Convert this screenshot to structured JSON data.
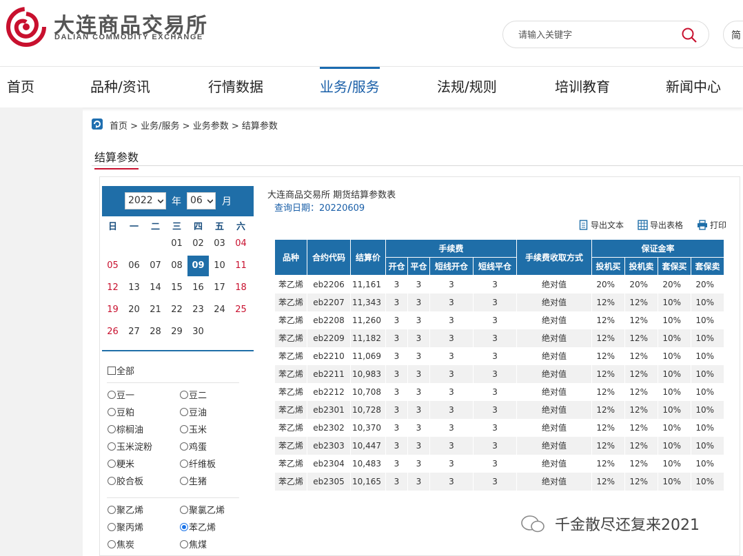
{
  "header": {
    "logo_cn": "大连商品交易所",
    "logo_en": "DALIAN COMMODITY EXCHANGE",
    "search_placeholder": "请输入关键字",
    "lang_label": "简"
  },
  "nav": [
    "首页",
    "品种/资讯",
    "行情数据",
    "业务/服务",
    "法规/规则",
    "培训教育",
    "新闻中心"
  ],
  "nav_active": "业务/服务",
  "breadcrumb": "首页 > 业务/服务 > 业务参数 > 结算参数",
  "page_title": "结算参数",
  "calendar": {
    "year": "2022",
    "year_label": "年",
    "month": "06",
    "month_label": "月",
    "weekdays": [
      "日",
      "一",
      "二",
      "三",
      "四",
      "五",
      "六"
    ],
    "first_weekday": 3,
    "days_in_month": 30,
    "selected_day": 9
  },
  "varieties": {
    "all_label": "全部",
    "group1": [
      "豆一",
      "豆二",
      "豆粕",
      "豆油",
      "棕榈油",
      "玉米",
      "玉米淀粉",
      "鸡蛋",
      "粳米",
      "纤维板",
      "胶合板",
      "生猪"
    ],
    "group2": [
      "聚乙烯",
      "聚氯乙烯",
      "聚丙烯",
      "苯乙烯",
      "焦炭",
      "焦煤"
    ],
    "selected": "苯乙烯"
  },
  "table": {
    "title": "大连商品交易所 期货结算参数表",
    "query_date": "查询日期：20220609",
    "tools": {
      "export_text": "导出文本",
      "export_table": "导出表格",
      "print": "打印"
    },
    "headers": {
      "variety": "品种",
      "contract": "合约代码",
      "settle_price": "结算价",
      "fee_group": "手续费",
      "fee_open": "开仓",
      "fee_close": "平仓",
      "fee_short_open": "短线开仓",
      "fee_short_close": "短线平仓",
      "fee_method": "手续费收取方式",
      "margin_group": "保证金率",
      "spec_buy": "投机买",
      "spec_sell": "投机卖",
      "hedge_buy": "套保买",
      "hedge_sell": "套保卖"
    },
    "rows": [
      [
        "苯乙烯",
        "eb2206",
        "11,161",
        "3",
        "3",
        "3",
        "3",
        "绝对值",
        "20%",
        "20%",
        "20%",
        "20%"
      ],
      [
        "苯乙烯",
        "eb2207",
        "11,343",
        "3",
        "3",
        "3",
        "3",
        "绝对值",
        "12%",
        "12%",
        "10%",
        "10%"
      ],
      [
        "苯乙烯",
        "eb2208",
        "11,260",
        "3",
        "3",
        "3",
        "3",
        "绝对值",
        "12%",
        "12%",
        "10%",
        "10%"
      ],
      [
        "苯乙烯",
        "eb2209",
        "11,182",
        "3",
        "3",
        "3",
        "3",
        "绝对值",
        "12%",
        "12%",
        "10%",
        "10%"
      ],
      [
        "苯乙烯",
        "eb2210",
        "11,069",
        "3",
        "3",
        "3",
        "3",
        "绝对值",
        "12%",
        "12%",
        "10%",
        "10%"
      ],
      [
        "苯乙烯",
        "eb2211",
        "10,983",
        "3",
        "3",
        "3",
        "3",
        "绝对值",
        "12%",
        "12%",
        "10%",
        "10%"
      ],
      [
        "苯乙烯",
        "eb2212",
        "10,708",
        "3",
        "3",
        "3",
        "3",
        "绝对值",
        "12%",
        "12%",
        "10%",
        "10%"
      ],
      [
        "苯乙烯",
        "eb2301",
        "10,728",
        "3",
        "3",
        "3",
        "3",
        "绝对值",
        "12%",
        "12%",
        "10%",
        "10%"
      ],
      [
        "苯乙烯",
        "eb2302",
        "10,370",
        "3",
        "3",
        "3",
        "3",
        "绝对值",
        "12%",
        "12%",
        "10%",
        "10%"
      ],
      [
        "苯乙烯",
        "eb2303",
        "10,447",
        "3",
        "3",
        "3",
        "3",
        "绝对值",
        "12%",
        "12%",
        "10%",
        "10%"
      ],
      [
        "苯乙烯",
        "eb2304",
        "10,483",
        "3",
        "3",
        "3",
        "3",
        "绝对值",
        "12%",
        "12%",
        "10%",
        "10%"
      ],
      [
        "苯乙烯",
        "eb2305",
        "10,165",
        "3",
        "3",
        "3",
        "3",
        "绝对值",
        "12%",
        "12%",
        "10%",
        "10%"
      ]
    ]
  },
  "watermark": "千金散尽还复来2021",
  "colors": {
    "brand_blue": "#1f6ea8",
    "brand_red": "#c8102e",
    "nav_active": "#1a5fa8"
  }
}
